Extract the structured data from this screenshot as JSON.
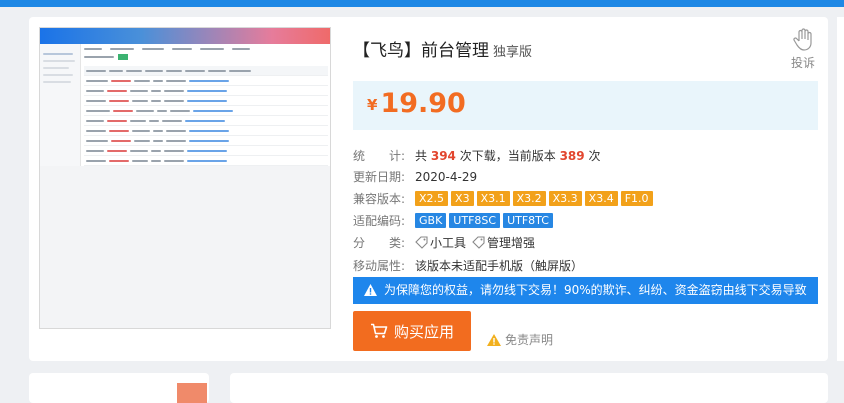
{
  "product": {
    "title": "【飞鸟】前台管理",
    "edition": "独享版",
    "report_label": "投诉",
    "price_currency": "¥",
    "price": "19.90"
  },
  "stats": {
    "label": "统　　计:",
    "text_prefix": "共",
    "downloads": "394",
    "text_mid": "次下载，当前版本",
    "current_version_downloads": "389",
    "text_suffix": "次"
  },
  "update": {
    "label": "更新日期:",
    "date": "2020-4-29"
  },
  "compat": {
    "label": "兼容版本:",
    "versions": [
      "X2.5",
      "X3",
      "X3.1",
      "X3.2",
      "X3.3",
      "X3.4",
      "F1.0"
    ]
  },
  "encoding": {
    "label": "适配编码:",
    "values": [
      "GBK",
      "UTF8SC",
      "UTF8TC"
    ]
  },
  "category": {
    "label": "分　　类:",
    "items": [
      "小工具",
      "管理增强"
    ]
  },
  "mobile": {
    "label": "移动属性:",
    "value": "该版本未适配手机版（触屏版）"
  },
  "notice": "为保障您的权益，请勿线下交易！90%的欺诈、纠纷、资金盗窃由线下交易导致",
  "buy_label": "购买应用",
  "disclaimer_label": "免责声明",
  "colors": {
    "accent_blue": "#1e86ec",
    "orange": "#f26c1f",
    "price_bg": "#e9f5fb",
    "tag_orange": "#f2a11a",
    "tag_blue": "#2787e3"
  },
  "icons": [
    "hand-icon",
    "warning-icon",
    "cart-icon",
    "tag-icon"
  ]
}
